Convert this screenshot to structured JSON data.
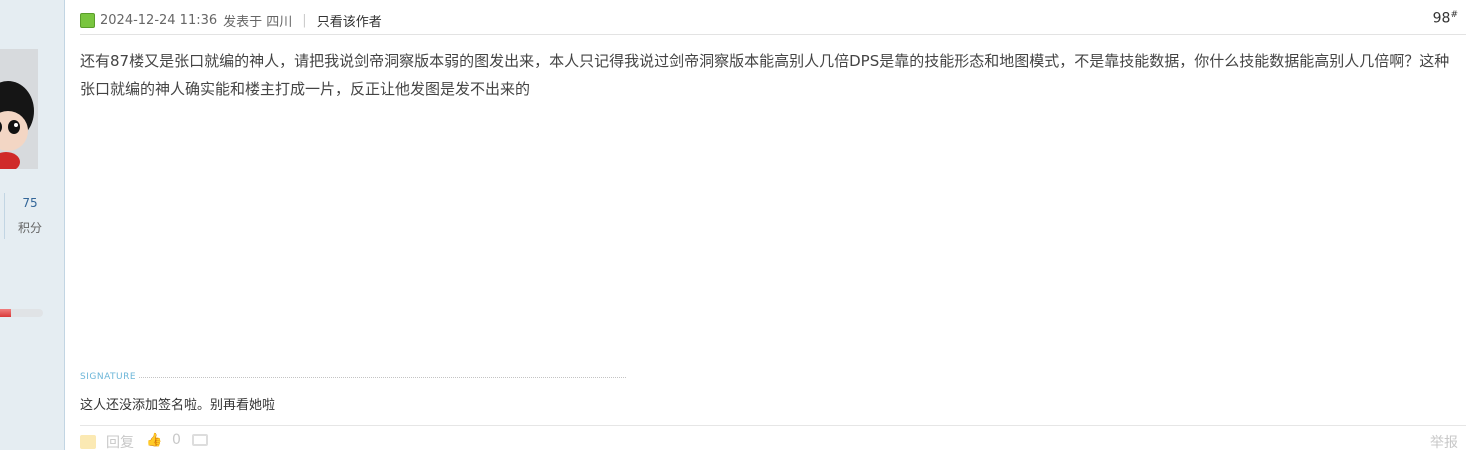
{
  "user": {
    "points_value": "75",
    "points_label": "积分",
    "level_progress": 0.25
  },
  "header": {
    "timestamp": "2024-12-24 11:36",
    "posted_from": "发表于 四川",
    "only_author": "只看该作者",
    "floor": "98",
    "floor_suffix": "#"
  },
  "post": {
    "content": "还有87楼又是张口就编的神人，请把我说剑帝洞察版本弱的图发出来，本人只记得我说过剑帝洞察版本能高别人几倍DPS是靠的技能形态和地图模式，不是靠技能数据，你什么技能数据能高别人几倍啊？这种张口就编的神人确实能和楼主打成一片，反正让他发图是发不出来的"
  },
  "signature": {
    "label": "SIGNATURE",
    "text": "这人还没添加签名啦。别再看她啦"
  },
  "footer": {
    "reply": "回复",
    "likes": "0",
    "report": "举报"
  },
  "icons": {
    "online": "online-status-icon",
    "reply": "reply-icon",
    "like": "thumbs-up-icon",
    "comment": "comment-icon"
  },
  "colors": {
    "sidebar_bg": "#e5edf2",
    "online_green": "#79c53f",
    "signature_blue": "#6cb6d8",
    "level_red": "#d93939"
  }
}
